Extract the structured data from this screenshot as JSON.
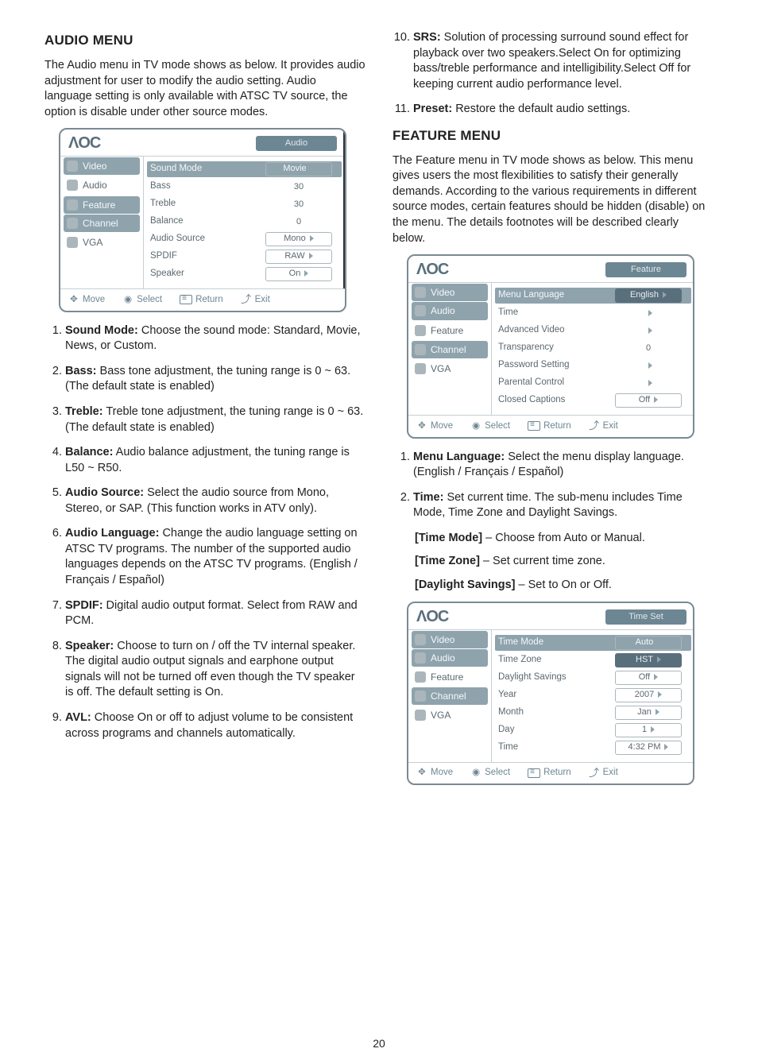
{
  "page_number": "20",
  "left": {
    "h_audio": "AUDIO MENU",
    "p_audio": "The Audio menu in TV mode shows as below. It provides audio adjustment for user to modify the audio setting. Audio language setting is only available with ATSC TV source, the option is disable under other source modes.",
    "list": [
      {
        "b": "Sound Mode:",
        "t": " Choose the sound mode: Standard, Movie, News, or Custom."
      },
      {
        "b": "Bass:",
        "t": " Bass tone adjustment, the tuning range is 0 ~ 63. (The default state is enabled)"
      },
      {
        "b": "Treble:",
        "t": " Treble tone adjustment, the tuning range is 0 ~ 63. (The default state is enabled)"
      },
      {
        "b": "Balance:",
        "t": " Audio balance adjustment, the tuning range is L50 ~ R50."
      },
      {
        "b": "Audio Source:",
        "t": " Select the audio source from Mono, Stereo, or SAP. (This function works in ATV only)."
      },
      {
        "b": "Audio Language:",
        "t": " Change the audio language setting on ATSC TV programs. The number of the supported audio languages depends on the ATSC TV programs. (English / Français / Español)"
      },
      {
        "b": "SPDIF:",
        "t": " Digital audio output format. Select from RAW and PCM."
      },
      {
        "b": "Speaker:",
        "t": " Choose to turn on / off the TV internal speaker. The digital audio output signals and earphone output signals will not be turned off even though the TV speaker is off. The default setting is On."
      },
      {
        "b": "AVL:",
        "t": " Choose On or off to adjust volume to be consistent across programs and channels automatically."
      }
    ]
  },
  "right": {
    "list10": {
      "b": "SRS:",
      "t": " Solution of processing surround sound effect for playback over two speakers.Select On for optimizing bass/treble performance and intelligibility.Select Off for keeping current audio performance level."
    },
    "list11": {
      "b": "Preset:",
      "t": " Restore the default audio settings."
    },
    "h_feature": "FEATURE MENU",
    "p_feature": "The Feature menu in TV mode shows as below. This menu gives users the most flexibilities to satisfy their generally demands. According to the various requirements in different source modes, certain features should be hidden (disable) on the menu. The details footnotes will be described clearly below.",
    "flist": [
      {
        "b": "Menu Language:",
        "t": " Select the menu display language. (English / Français / Español)"
      },
      {
        "b": "Time:",
        "t": " Set current time. The sub-menu includes Time Mode, Time Zone and Daylight Savings."
      }
    ],
    "sub_tm_b": "[Time Mode]",
    "sub_tm_t": " – Choose from Auto or Manual.",
    "sub_tz_b": "[Time Zone]",
    "sub_tz_t": " – Set current time zone.",
    "sub_ds_b": "[Daylight Savings]",
    "sub_ds_t": " – Set to On or Off."
  },
  "nav": {
    "video": "Video",
    "audio": "Audio",
    "feature": "Feature",
    "channel": "Channel",
    "vga": "VGA"
  },
  "foot": {
    "move": "Move",
    "select": "Select",
    "ret": "Return",
    "exit": "Exit"
  },
  "osd_audio": {
    "logo": "ΛOC",
    "title": "Audio",
    "rows": [
      {
        "l": "Sound Mode",
        "v": "Movie",
        "chip": true,
        "sel": true
      },
      {
        "l": "Bass",
        "v": "30"
      },
      {
        "l": "Treble",
        "v": "30"
      },
      {
        "l": "Balance",
        "v": "0"
      },
      {
        "l": "Audio Source",
        "v": "Mono",
        "chip": true
      },
      {
        "l": "SPDIF",
        "v": "RAW",
        "chip": true
      },
      {
        "l": "Speaker",
        "v": "On",
        "chip": true
      }
    ]
  },
  "osd_feature": {
    "logo": "ΛOC",
    "title": "Feature",
    "rows": [
      {
        "l": "Menu Language",
        "v": "English",
        "chip": true,
        "dark": true,
        "sel": true
      },
      {
        "l": "Time",
        "v": "",
        "tri": true
      },
      {
        "l": "Advanced Video",
        "v": "",
        "tri": true
      },
      {
        "l": "Transparency",
        "v": "0"
      },
      {
        "l": "Password Setting",
        "v": "",
        "tri": true
      },
      {
        "l": "Parental Control",
        "v": "",
        "tri": true
      },
      {
        "l": "Closed Captions",
        "v": "Off",
        "chip": true
      }
    ]
  },
  "osd_time": {
    "logo": "ΛOC",
    "title": "Time Set",
    "rows": [
      {
        "l": "Time Mode",
        "v": "Auto",
        "chip": true,
        "sel": true
      },
      {
        "l": "Time Zone",
        "v": "HST",
        "chip": true,
        "dark": true
      },
      {
        "l": "Daylight Savings",
        "v": "Off",
        "chip": true
      },
      {
        "l": "Year",
        "v": "2007",
        "chip": true
      },
      {
        "l": "Month",
        "v": "Jan",
        "chip": true
      },
      {
        "l": "Day",
        "v": "1",
        "chip": true
      },
      {
        "l": "Time",
        "v": "4:32 PM",
        "chip": true
      }
    ]
  }
}
